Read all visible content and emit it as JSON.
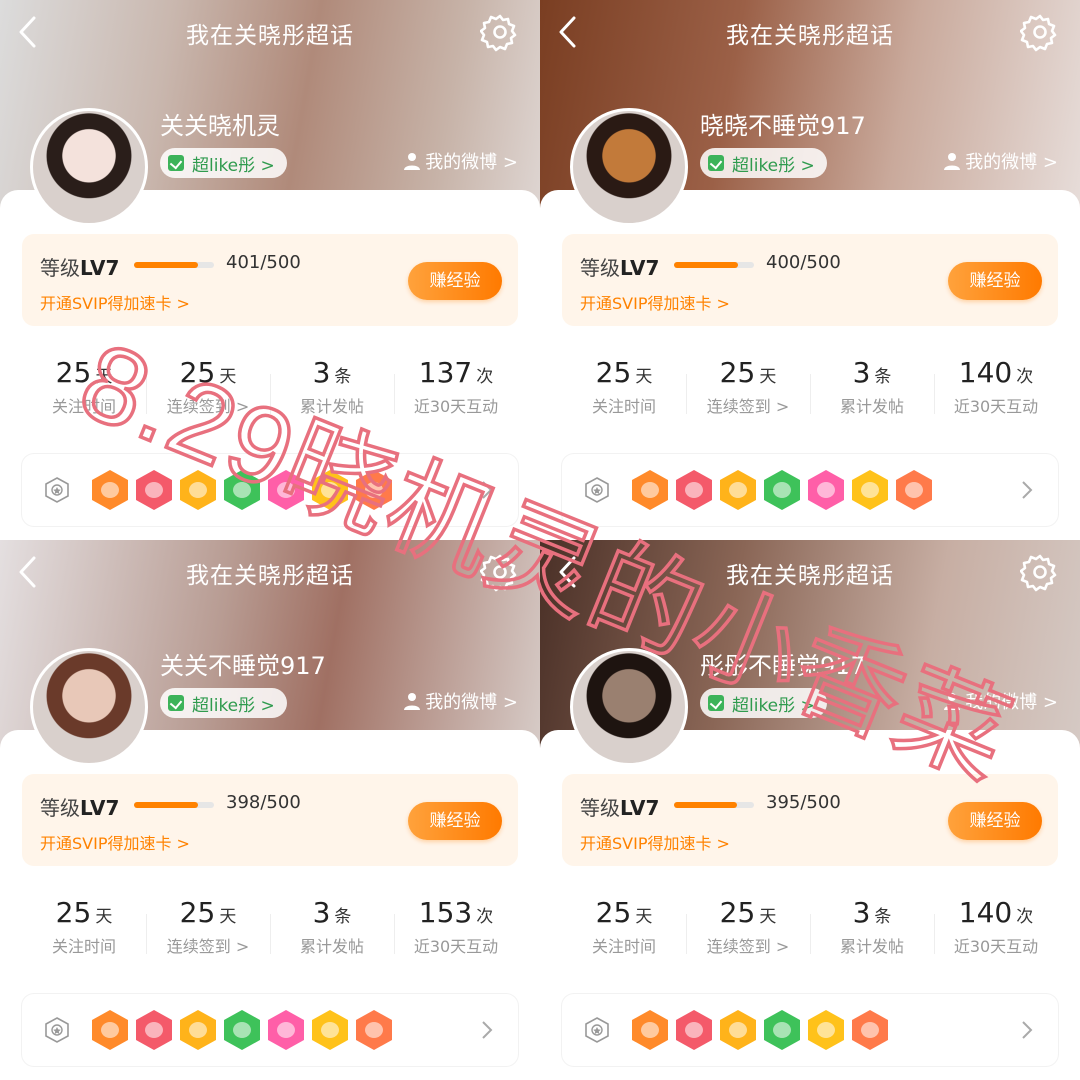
{
  "panels": [
    {
      "title": "我在关晓彤超话",
      "name": "关关晓机灵",
      "pill": "超like彤 >",
      "my_weibo": "我的微博 >",
      "level_label": "等级",
      "level": "LV7",
      "progress_text": "401/500",
      "progress_fraction": 0.802,
      "svip": "开通SVIP得加速卡 >",
      "earn_btn": "赚经验",
      "stats": [
        {
          "num": "25",
          "unit": "天",
          "label": "关注时间"
        },
        {
          "num": "25",
          "unit": "天",
          "label": "连续签到 >"
        },
        {
          "num": "3",
          "unit": "条",
          "label": "累计发帖"
        },
        {
          "num": "137",
          "unit": "次",
          "label": "近30天互动"
        }
      ],
      "badge_colors": [
        "#ff8a2a",
        "#f45a6a",
        "#ffb31a",
        "#3ec25a",
        "#ff5fa8",
        "#ffc21a",
        "#ff7a4a"
      ],
      "bg": "bg-1",
      "avatar_colors": [
        "#f4e2dc",
        "#2a1e1a"
      ]
    },
    {
      "title": "我在关晓彤超话",
      "name": "晓晓不睡觉917",
      "pill": "超like彤 >",
      "my_weibo": "我的微博 >",
      "level_label": "等级",
      "level": "LV7",
      "progress_text": "400/500",
      "progress_fraction": 0.8,
      "svip": "开通SVIP得加速卡 >",
      "earn_btn": "赚经验",
      "stats": [
        {
          "num": "25",
          "unit": "天",
          "label": "关注时间"
        },
        {
          "num": "25",
          "unit": "天",
          "label": "连续签到 >"
        },
        {
          "num": "3",
          "unit": "条",
          "label": "累计发帖"
        },
        {
          "num": "140",
          "unit": "次",
          "label": "近30天互动"
        }
      ],
      "badge_colors": [
        "#ff8a2a",
        "#f45a6a",
        "#ffb31a",
        "#3ec25a",
        "#ff5fa8",
        "#ffc21a",
        "#ff7a4a"
      ],
      "bg": "bg-2",
      "avatar_colors": [
        "#c27a3a",
        "#2a1a14"
      ]
    },
    {
      "title": "我在关晓彤超话",
      "name": "关关不睡觉917",
      "pill": "超like彤 >",
      "my_weibo": "我的微博 >",
      "level_label": "等级",
      "level": "LV7",
      "progress_text": "398/500",
      "progress_fraction": 0.796,
      "svip": "开通SVIP得加速卡 >",
      "earn_btn": "赚经验",
      "stats": [
        {
          "num": "25",
          "unit": "天",
          "label": "关注时间"
        },
        {
          "num": "25",
          "unit": "天",
          "label": "连续签到 >"
        },
        {
          "num": "3",
          "unit": "条",
          "label": "累计发帖"
        },
        {
          "num": "153",
          "unit": "次",
          "label": "近30天互动"
        }
      ],
      "badge_colors": [
        "#ff8a2a",
        "#f45a6a",
        "#ffb31a",
        "#3ec25a",
        "#ff5fa8",
        "#ffc21a",
        "#ff7a4a"
      ],
      "bg": "bg-3",
      "avatar_colors": [
        "#e8c8b8",
        "#6a3a2a"
      ]
    },
    {
      "title": "我在关晓彤超话",
      "name": "彤彤不睡觉917",
      "pill": "超like彤 >",
      "my_weibo": "我的微博 >",
      "level_label": "等级",
      "level": "LV7",
      "progress_text": "395/500",
      "progress_fraction": 0.79,
      "svip": "开通SVIP得加速卡 >",
      "earn_btn": "赚经验",
      "stats": [
        {
          "num": "25",
          "unit": "天",
          "label": "关注时间"
        },
        {
          "num": "25",
          "unit": "天",
          "label": "连续签到 >"
        },
        {
          "num": "3",
          "unit": "条",
          "label": "累计发帖"
        },
        {
          "num": "140",
          "unit": "次",
          "label": "近30天互动"
        }
      ],
      "badge_colors": [
        "#ff8a2a",
        "#f45a6a",
        "#ffb31a",
        "#3ec25a",
        "#ffc21a",
        "#ff7a4a"
      ],
      "bg": "bg-4",
      "avatar_colors": [
        "#9a8070",
        "#1e1410"
      ]
    }
  ],
  "overlay": {
    "watermark_text": "8.29晓机灵的小香菜",
    "watermark_color": "#e8707e"
  },
  "icons": {
    "back": "chevron-left-icon",
    "settings": "gear-icon",
    "my_weibo": "person-icon",
    "badge_wall": "badge-medal-icon",
    "more": "chevron-right-icon"
  }
}
